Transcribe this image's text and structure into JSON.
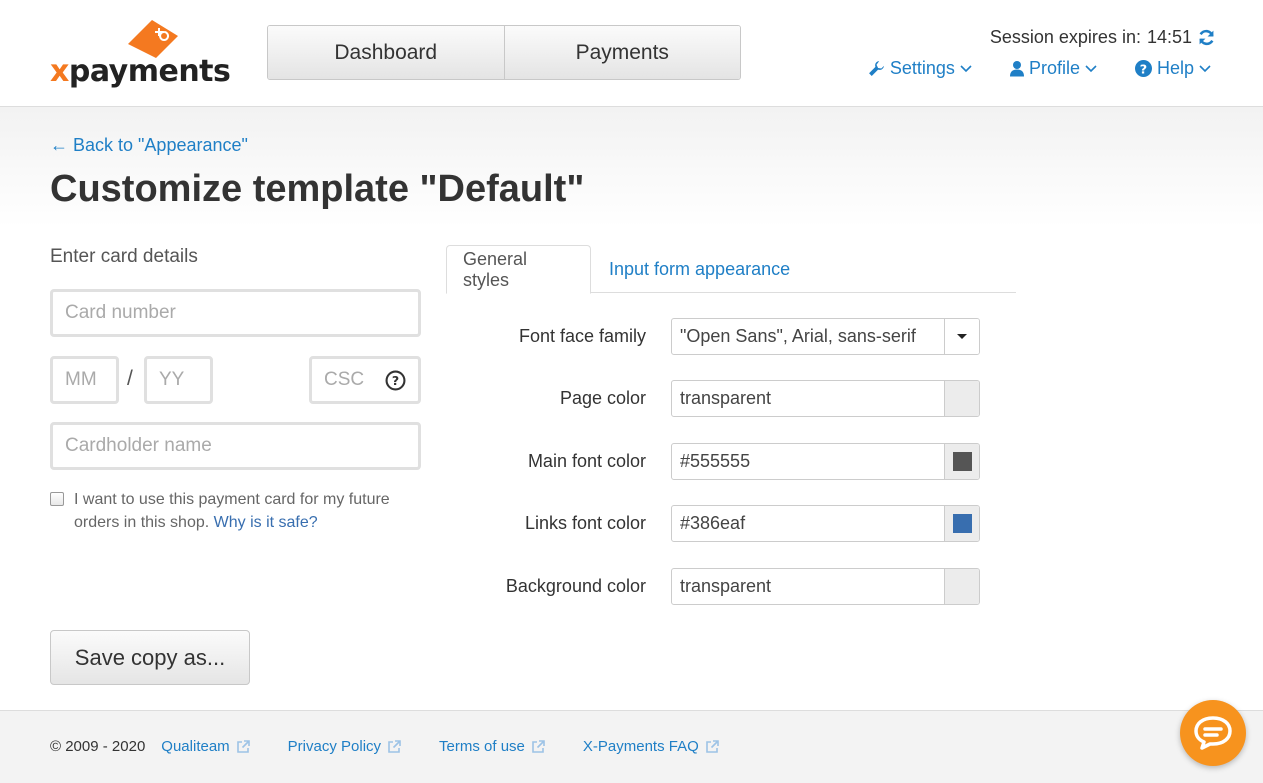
{
  "brand": {
    "logo_prefix": "x",
    "logo_rest": "payments",
    "accent_color": "#f47920"
  },
  "nav": {
    "dashboard": "Dashboard",
    "payments": "Payments"
  },
  "session": {
    "label": "Session expires in:",
    "time": "14:51"
  },
  "menu": {
    "settings": "Settings",
    "profile": "Profile",
    "help": "Help"
  },
  "back_link": "← Back to \"Appearance\"",
  "page_title": "Customize template \"Default\"",
  "card_form": {
    "heading": "Enter card details",
    "card_number_placeholder": "Card number",
    "month_placeholder": "MM",
    "slash": "/",
    "year_placeholder": "YY",
    "csc_placeholder": "CSC",
    "cardholder_placeholder": "Cardholder name",
    "save_card_text": "I want to use this payment card for my future orders in this shop.",
    "why_safe_link": "Why is it safe?",
    "save_card_checked": false
  },
  "save_copy_button": "Save copy as...",
  "tabs": {
    "general": "General styles",
    "input_form": "Input form appearance"
  },
  "styles": {
    "font_family_label": "Font face family",
    "font_family_value": "\"Open Sans\", Arial, sans-serif",
    "page_color_label": "Page color",
    "page_color_value": "transparent",
    "main_font_color_label": "Main font color",
    "main_font_color_value": "#555555",
    "links_font_color_label": "Links font color",
    "links_font_color_value": "#386eaf",
    "background_color_label": "Background color",
    "background_color_value": "transparent"
  },
  "footer": {
    "copyright": "© 2009 - 2020",
    "qualiteam": "Qualiteam",
    "privacy": "Privacy Policy",
    "terms": "Terms of use",
    "faq": "X-Payments FAQ"
  },
  "colors": {
    "link": "#1f7fc6",
    "chat_button": "#f7931e"
  }
}
